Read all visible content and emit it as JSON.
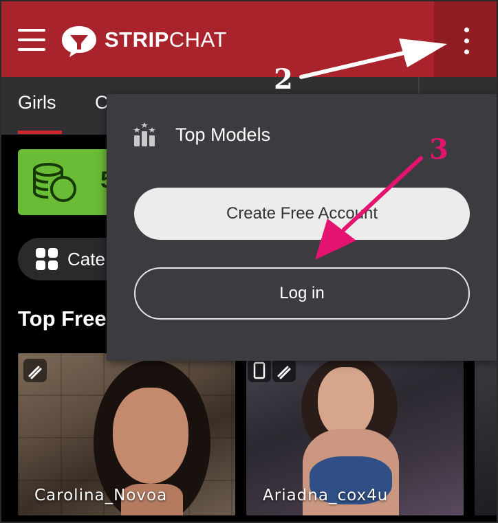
{
  "header": {
    "logo_bold": "STRIP",
    "logo_light": "CHAT"
  },
  "tabs": {
    "items": [
      {
        "label": "Girls"
      },
      {
        "label": "C"
      }
    ]
  },
  "promo": {
    "text": "5"
  },
  "categories": {
    "label": "Cate"
  },
  "section": {
    "title": "Top Free"
  },
  "cards": [
    {
      "name": "Carolina_Novoa"
    },
    {
      "name": "Ariadna_cox4u"
    }
  ],
  "dropdown": {
    "top_models_label": "Top Models",
    "create_account_label": "Create Free Account",
    "login_label": "Log in"
  },
  "annotations": {
    "step2": "2",
    "step3": "3"
  },
  "colors": {
    "header_bg": "#a8232b",
    "accent_red": "#d1262e",
    "promo_green": "#6abb35",
    "annotation_magenta": "#e3136f"
  }
}
